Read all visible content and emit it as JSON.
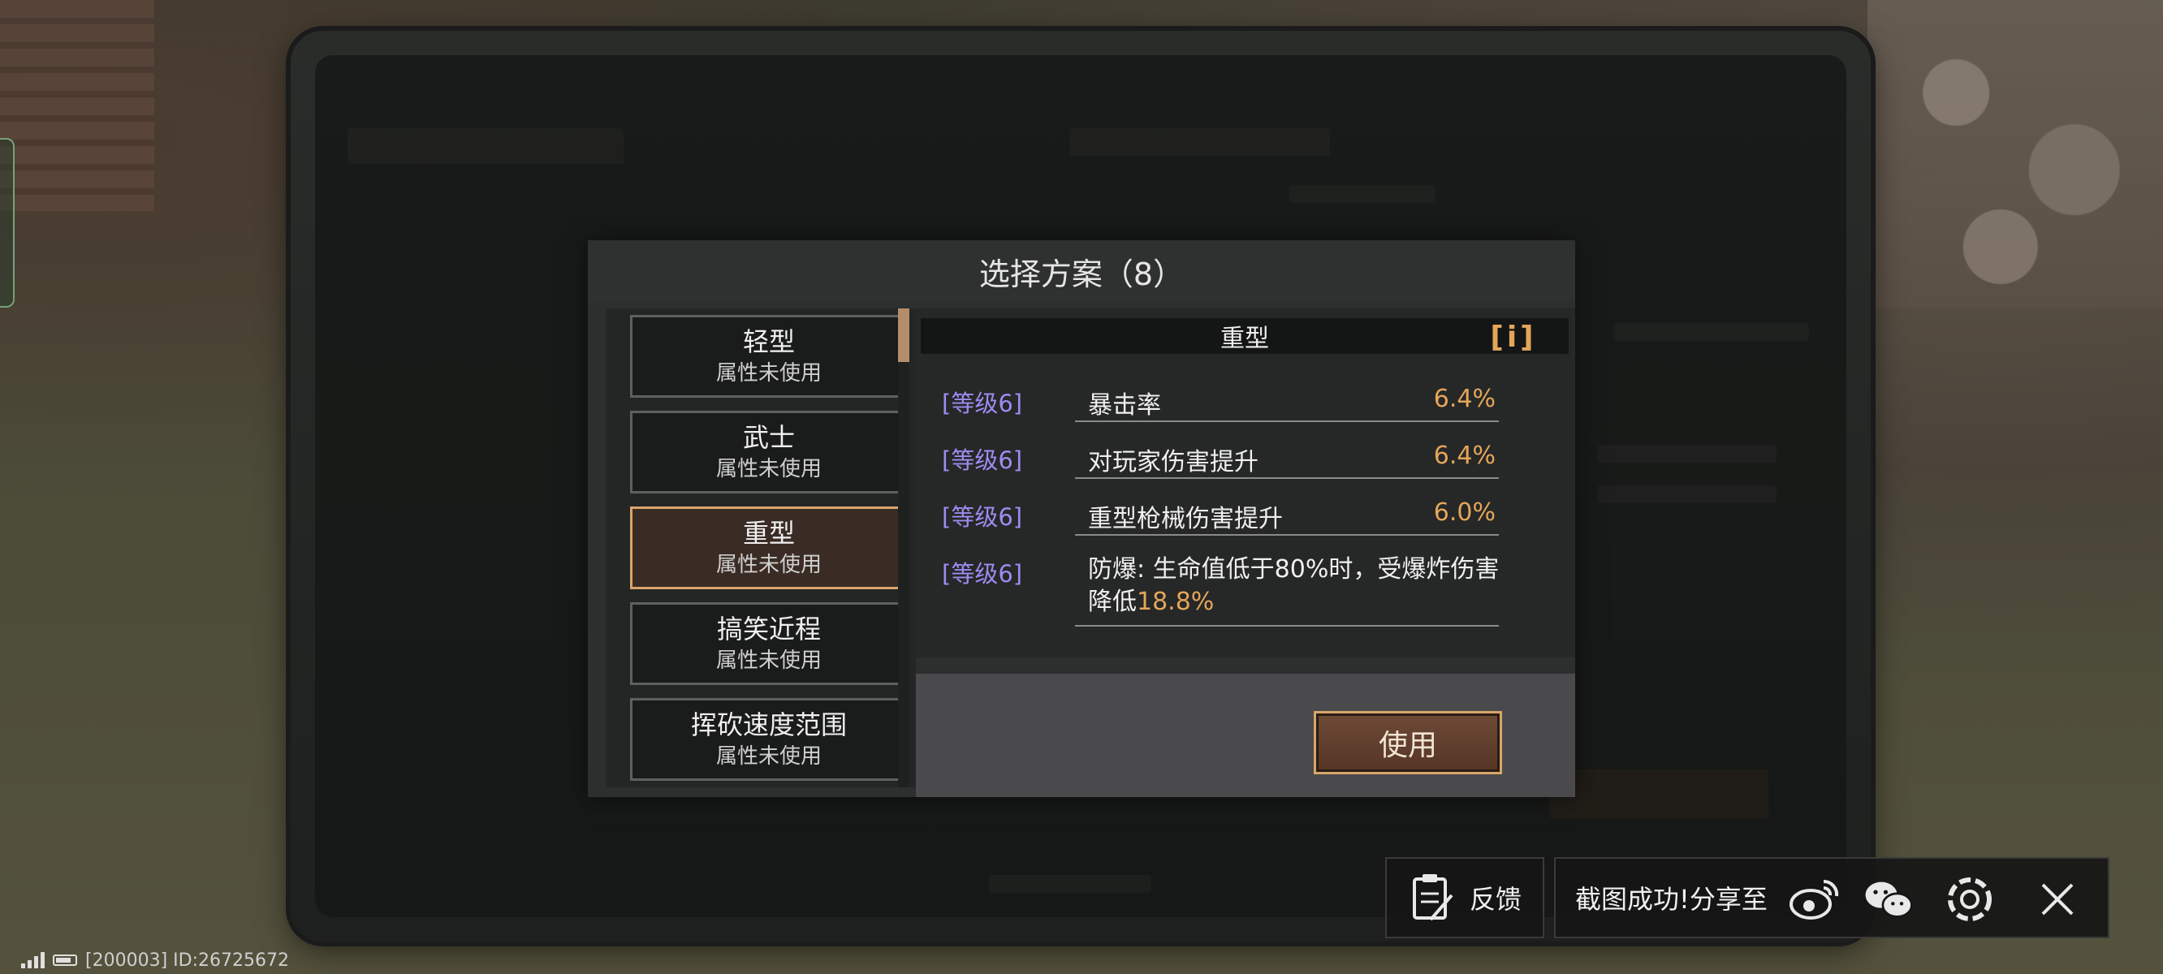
{
  "modal": {
    "title": "选择方案（8）",
    "schemes": [
      {
        "name": "轻型",
        "status": "属性未使用",
        "selected": false
      },
      {
        "name": "武士",
        "status": "属性未使用",
        "selected": false
      },
      {
        "name": "重型",
        "status": "属性未使用",
        "selected": true
      },
      {
        "name": "搞笑近程",
        "status": "属性未使用",
        "selected": false
      },
      {
        "name": "挥砍速度范围",
        "status": "属性未使用",
        "selected": false
      }
    ],
    "detail": {
      "header": "重型",
      "info_icon": "[i]",
      "attributes": [
        {
          "level": "[等级6]",
          "name": "暴击率",
          "value": "6.4%"
        },
        {
          "level": "[等级6]",
          "name": "对玩家伤害提升",
          "value": "6.4%"
        },
        {
          "level": "[等级6]",
          "name": "重型枪械伤害提升",
          "value": "6.0%"
        },
        {
          "level": "[等级6]",
          "text": "防爆: 生命值低于80%时，受爆炸伤害降低",
          "highlight": "18.8%"
        }
      ]
    },
    "use_button": "使用"
  },
  "toolbar": {
    "feedback_label": "反馈",
    "share_label": "截图成功!分享至",
    "icons": [
      "feedback-icon",
      "weibo-icon",
      "wechat-icon",
      "moments-icon",
      "close-icon"
    ]
  },
  "status_bar": {
    "id_text": "[200003] ID:26725672"
  },
  "colors": {
    "accent_orange": "#e3a659",
    "level_purple": "#9b8cf0",
    "selected_border": "#d7a669"
  }
}
